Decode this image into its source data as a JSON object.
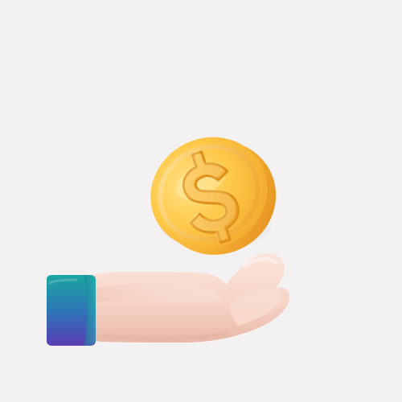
{
  "scene": {
    "background_color": "#f4f1f2",
    "subjects": [
      {
        "icon": "gold-dollar-coin-icon",
        "glyph": "$"
      },
      {
        "icon": "open-palm-hand-icon"
      },
      {
        "icon": "blue-sleeve-cuff-icon"
      }
    ],
    "colors": {
      "coin_face": "#ffc949",
      "coin_edge": "#f2a828",
      "coin_glyph": "#f6b12d",
      "skin": "#f6d4c6",
      "cuff_top": "#1aa7a0",
      "cuff_bottom": "#5a3db5"
    }
  }
}
